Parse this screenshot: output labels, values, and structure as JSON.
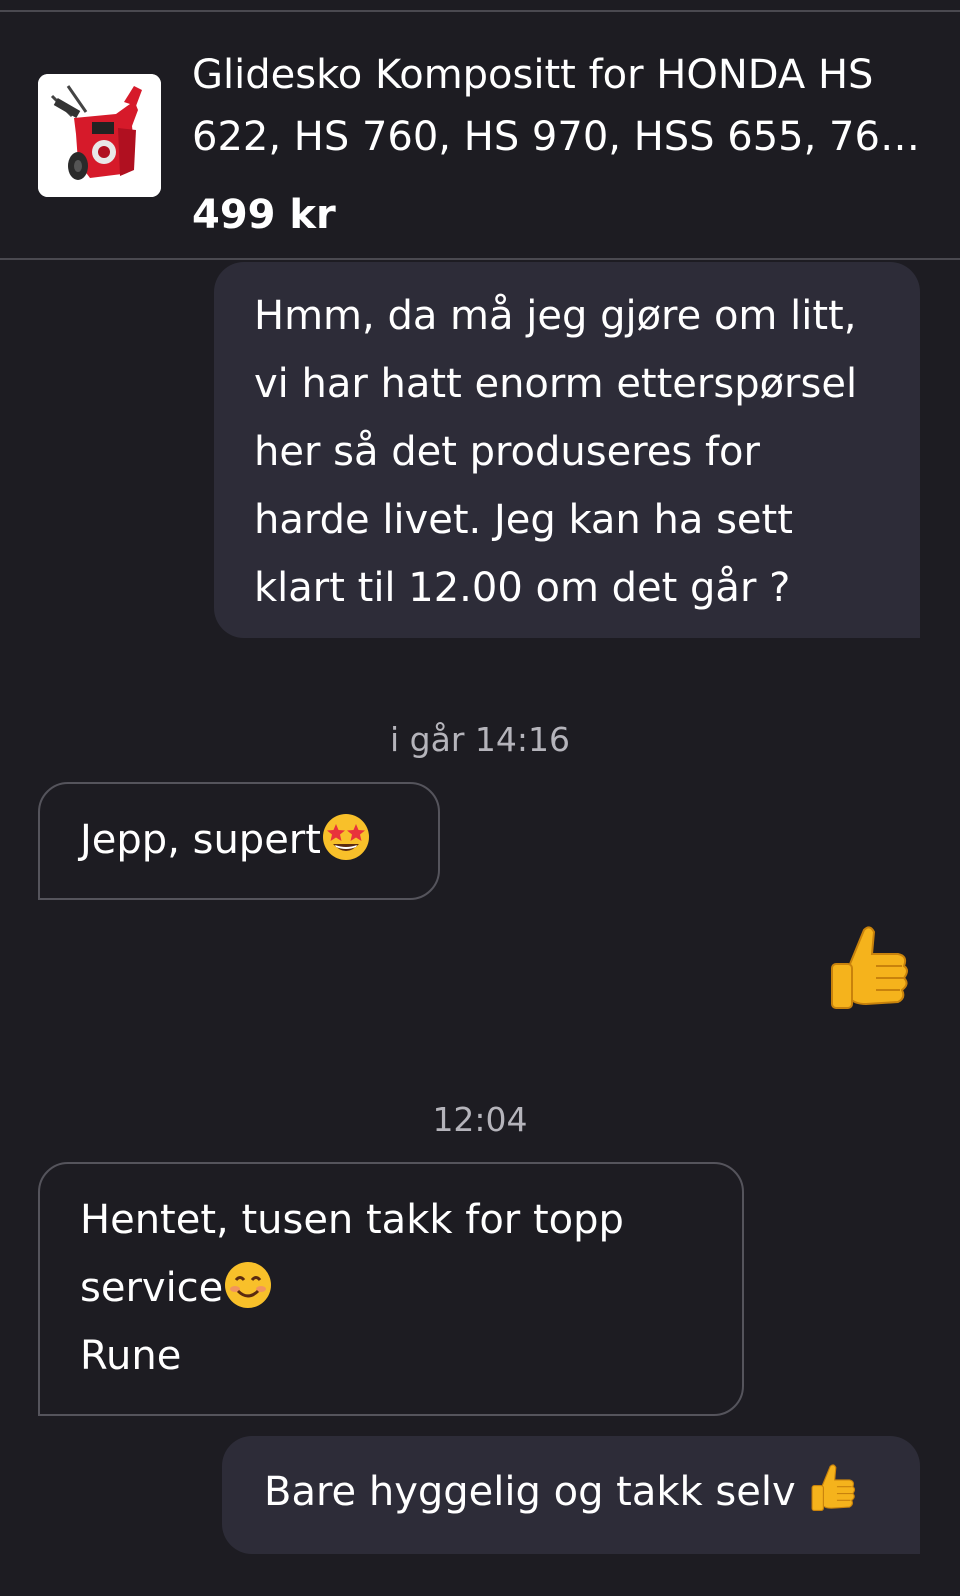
{
  "product": {
    "title": "Glidesko Kompositt for HONDA HS 622, HS 760, HS 970, HSS 655, 760 ...",
    "price": "499 kr",
    "image_icon": "snowblower-thumbnail"
  },
  "messages": [
    {
      "direction": "outgoing",
      "lines": [
        "Hmm, da må jeg gjøre om litt,",
        "vi har hatt enorm etterspørsel",
        "her så det produseres for",
        "harde livet. Jeg kan ha sett",
        "klart til 12.00 om det går ?"
      ]
    },
    {
      "timestamp": "i går 14:16"
    },
    {
      "direction": "incoming",
      "lines": [
        "Jepp, supert"
      ],
      "emoji": "star-struck-emoji"
    },
    {
      "direction": "outgoing",
      "emoji_only": "thumbs-up-emoji"
    },
    {
      "timestamp": "12:04"
    },
    {
      "direction": "incoming",
      "lines": [
        "Hentet, tusen takk for topp",
        "service",
        "Rune"
      ],
      "emoji": "smiling-face-emoji"
    },
    {
      "direction": "outgoing",
      "lines": [
        "Bare hyggelig og takk selv"
      ],
      "emoji": "thumbs-up-emoji"
    }
  ],
  "colors": {
    "background": "#1d1c22",
    "outgoing_bubble": "#2d2c38",
    "incoming_border": "#55545c",
    "timestamp_text": "#b5b4bb"
  }
}
